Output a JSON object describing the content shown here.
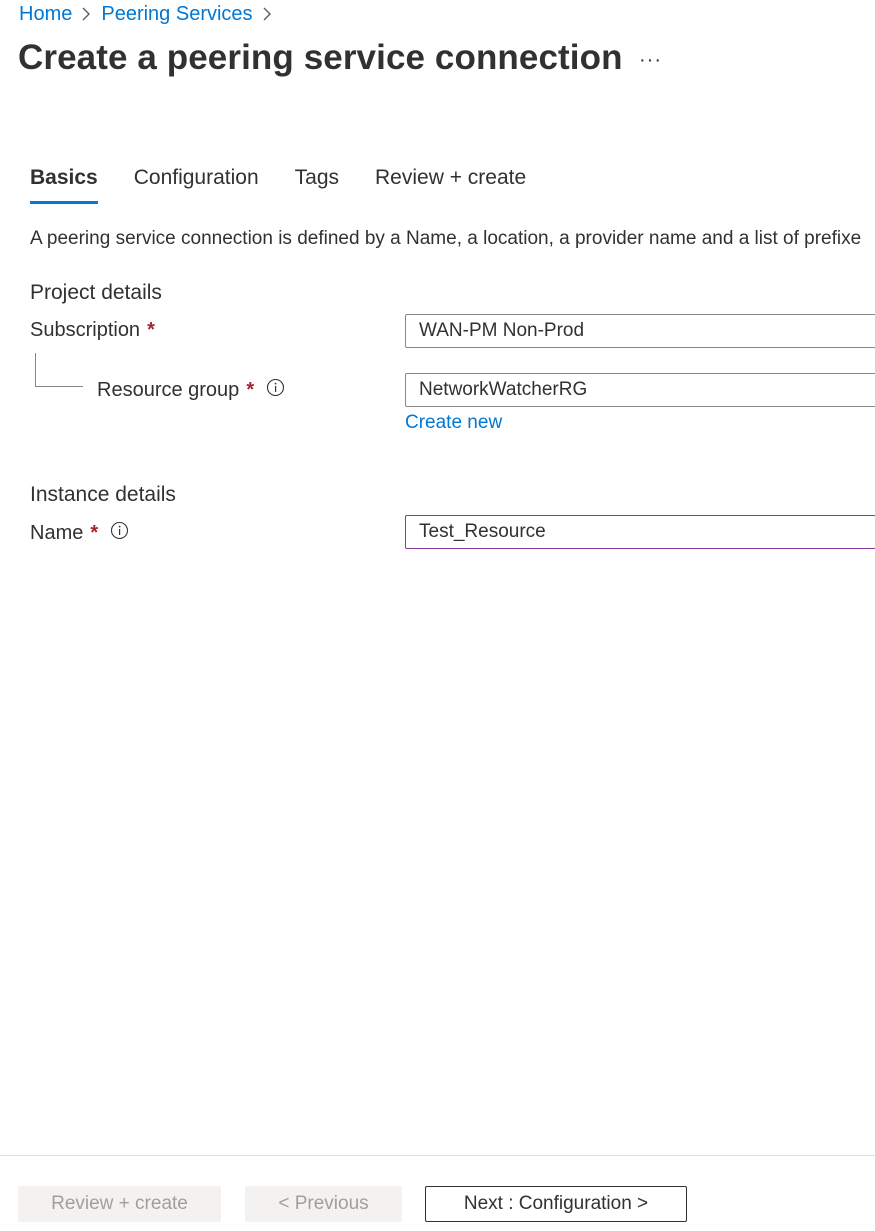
{
  "breadcrumb": {
    "items": [
      "Home",
      "Peering Services"
    ]
  },
  "page": {
    "title": "Create a peering service connection",
    "more_label": "···"
  },
  "tabs": [
    {
      "label": "Basics",
      "active": true
    },
    {
      "label": "Configuration",
      "active": false
    },
    {
      "label": "Tags",
      "active": false
    },
    {
      "label": "Review + create",
      "active": false
    }
  ],
  "description": "A peering service connection is defined by a Name, a location, a provider name and a list of prefixe",
  "project_details": {
    "title": "Project details",
    "subscription_label": "Subscription",
    "subscription_value": "WAN-PM Non-Prod",
    "resource_group_label": "Resource group",
    "resource_group_value": "NetworkWatcherRG",
    "create_new_label": "Create new"
  },
  "instance_details": {
    "title": "Instance details",
    "name_label": "Name",
    "name_value": "Test_Resource"
  },
  "required_marker": "*",
  "footer": {
    "review_create_label": "Review + create",
    "previous_label": "< Previous",
    "next_label": "Next : Configuration >"
  },
  "colors": {
    "accent": "#0078d4",
    "required": "#a4262c",
    "focus_border": "#8a3a9e"
  }
}
